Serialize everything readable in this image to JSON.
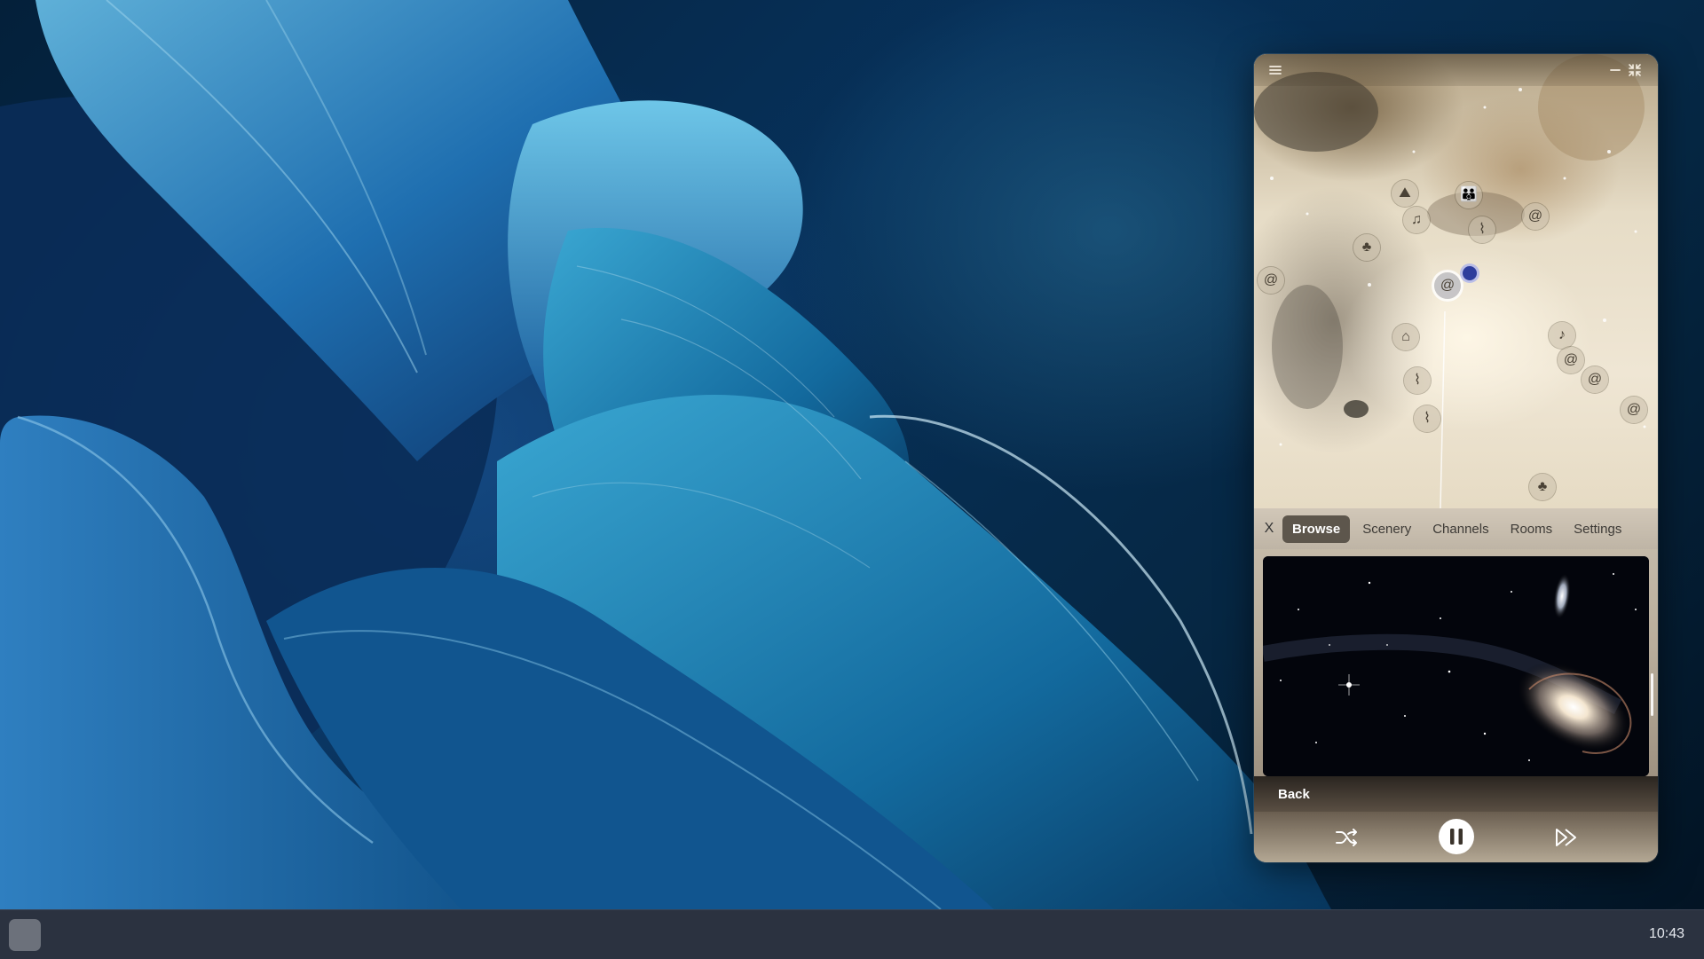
{
  "app": {
    "menu_icon": "hamburger-icon",
    "minimize_icon": "minimize-icon",
    "fullscreen_icon": "collapse-icon",
    "map_pins": [
      {
        "icon": "mountain-icon",
        "glyph": "⛰"
      },
      {
        "icon": "people-icon",
        "glyph": "👪"
      },
      {
        "icon": "music-note-icon",
        "glyph": "♫"
      },
      {
        "icon": "jellyfish-icon",
        "glyph": "⌇"
      },
      {
        "icon": "galaxy-icon",
        "glyph": "@"
      },
      {
        "icon": "forest-icon",
        "glyph": "♣"
      },
      {
        "icon": "galaxy-icon",
        "glyph": "@"
      },
      {
        "icon": "galaxy-icon",
        "glyph": "@"
      },
      {
        "icon": "cat-icon",
        "glyph": "⌂"
      },
      {
        "icon": "music-note-icon",
        "glyph": "♪"
      },
      {
        "icon": "galaxy-icon",
        "glyph": "@"
      },
      {
        "icon": "galaxy-icon",
        "glyph": "@"
      },
      {
        "icon": "galaxy-icon",
        "glyph": "@"
      },
      {
        "icon": "jellyfish-icon",
        "glyph": "⌇"
      },
      {
        "icon": "jellyfish-icon",
        "glyph": "⌇"
      },
      {
        "icon": "forest-icon",
        "glyph": "♣"
      }
    ],
    "tabs": {
      "close": "X",
      "browse": "Browse",
      "scenery": "Scenery",
      "channels": "Channels",
      "rooms": "Rooms",
      "settings": "Settings",
      "active": "Browse"
    },
    "media_card": {
      "image": "galaxy-image"
    },
    "back_label": "Back",
    "controls": {
      "shuffle_icon": "shuffle-icon",
      "pause_icon": "pause-icon",
      "skip_icon": "skip-forward-icon",
      "state": "playing"
    }
  },
  "taskbar": {
    "start_icon": "start-button-icon",
    "clock": "10:43"
  }
}
